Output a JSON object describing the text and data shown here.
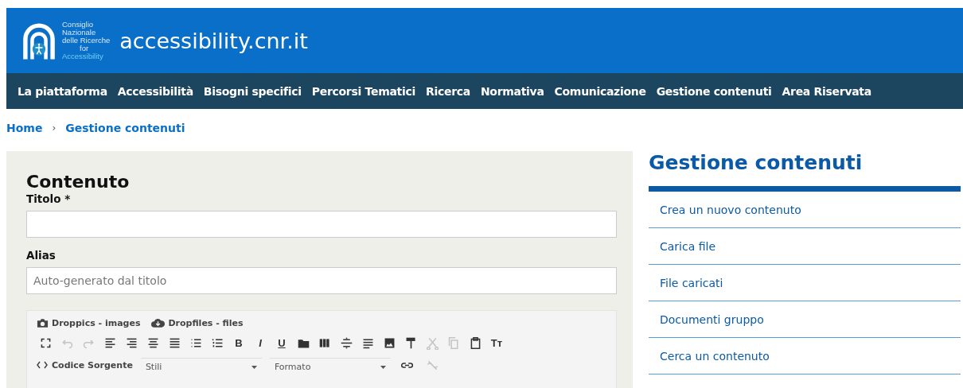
{
  "header": {
    "logo_lines": [
      "Consiglio",
      "Nazionale",
      "delle Ricerche",
      "for"
    ],
    "logo_accent": "Accessibility",
    "site_title": "accessibility.cnr.it"
  },
  "nav": [
    "La piattaforma",
    "Accessibilità",
    "Bisogni specifici",
    "Percorsi Tematici",
    "Ricerca",
    "Normativa",
    "Comunicazione",
    "Gestione contenuti",
    "Area Riservata"
  ],
  "breadcrumb": [
    "Home",
    "›",
    "Gestione contenuti"
  ],
  "form": {
    "heading": "Contenuto",
    "fields": [
      {
        "label": "Titolo *"
      },
      {
        "label": "Alias",
        "placeholder": "Auto-generato dal titolo"
      }
    ],
    "editor": {
      "plugins": [
        {
          "kind": "camera",
          "label": "Droppics - images"
        },
        {
          "kind": "cloud",
          "label": "Dropfiles - files"
        }
      ],
      "toolbar": [
        {
          "kind": "fullscreen",
          "disabled": false
        },
        {
          "kind": "undo",
          "disabled": true
        },
        {
          "kind": "redo",
          "disabled": true
        },
        {
          "kind": "align-left",
          "disabled": false
        },
        {
          "kind": "align-right",
          "disabled": false
        },
        {
          "kind": "align-center",
          "disabled": false
        },
        {
          "kind": "justify",
          "disabled": false
        },
        {
          "kind": "bullets",
          "disabled": false
        },
        {
          "kind": "numbers",
          "disabled": false
        },
        {
          "kind": "bold",
          "label": "B",
          "disabled": false
        },
        {
          "kind": "italic",
          "label": "I",
          "disabled": false
        },
        {
          "kind": "underline",
          "label": "U",
          "disabled": false
        },
        {
          "kind": "folder",
          "disabled": false
        },
        {
          "kind": "columns",
          "disabled": false
        },
        {
          "kind": "hr",
          "disabled": false
        },
        {
          "kind": "paragraph",
          "disabled": false
        },
        {
          "kind": "image",
          "disabled": false
        },
        {
          "kind": "paint",
          "disabled": false
        },
        {
          "kind": "cut",
          "disabled": true
        },
        {
          "kind": "copy",
          "disabled": true
        },
        {
          "kind": "paste",
          "disabled": false
        },
        {
          "kind": "textsize",
          "label": "Tт",
          "disabled": false
        }
      ],
      "source_label": "Codice Sorgente",
      "dropdowns": [
        "Stili",
        "Formato"
      ],
      "row3": [
        {
          "kind": "link",
          "disabled": false
        },
        {
          "kind": "unlink",
          "disabled": true
        }
      ]
    }
  },
  "sidebar": {
    "title": "Gestione contenuti",
    "links": [
      "Crea un nuovo contenuto",
      "Carica file",
      "File caricati",
      "Documenti gruppo",
      "Cerca un contenuto"
    ]
  }
}
